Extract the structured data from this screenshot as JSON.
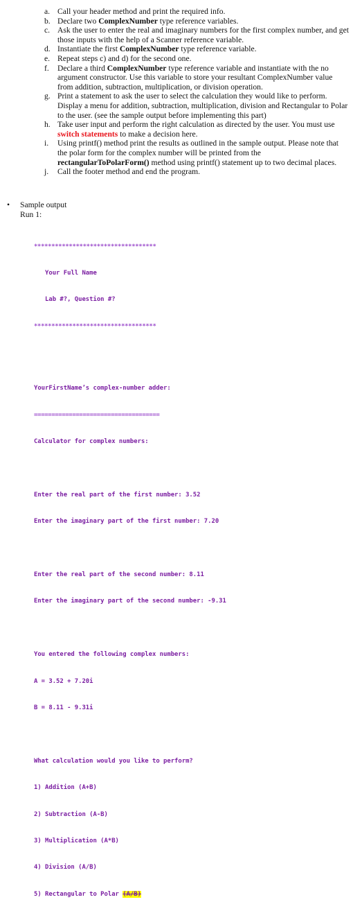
{
  "steps": [
    {
      "label": "a.",
      "parts": [
        {
          "t": "Call your header method and print the required info."
        }
      ]
    },
    {
      "label": "b.",
      "parts": [
        {
          "t": "Declare two "
        },
        {
          "t": "ComplexNumber",
          "b": true
        },
        {
          "t": " type reference variables."
        }
      ]
    },
    {
      "label": "c.",
      "parts": [
        {
          "t": "Ask the user to enter the real and imaginary numbers for the first complex number, and get those inputs with the help of a Scanner reference variable."
        }
      ]
    },
    {
      "label": "d.",
      "parts": [
        {
          "t": "Instantiate the first "
        },
        {
          "t": "ComplexNumber",
          "b": true
        },
        {
          "t": " type reference variable."
        }
      ]
    },
    {
      "label": "e.",
      "parts": [
        {
          "t": "Repeat steps c) and d) for the second one."
        }
      ]
    },
    {
      "label": "f.",
      "parts": [
        {
          "t": "Declare a third "
        },
        {
          "t": "ComplexNumber",
          "b": true
        },
        {
          "t": " type reference variable and instantiate with the no argument constructor. Use this variable to store your resultant ComplexNumber value from addition, subtraction, multiplication, or division operation."
        }
      ]
    },
    {
      "label": "g.",
      "parts": [
        {
          "t": "Print a statement to ask the user to select the calculation they would like to perform. Display a menu for addition, subtraction, multiplication, division and Rectangular to Polar to the user. (see the sample output before implementing this part)"
        }
      ]
    },
    {
      "label": "h.",
      "parts": [
        {
          "t": "Take user input and perform the right calculation as directed by the user. You must use "
        },
        {
          "t": "switch statements",
          "red": true
        },
        {
          "t": " to make a decision here."
        }
      ]
    },
    {
      "label": "i.",
      "parts": [
        {
          "t": "Using printf() method print the results as outlined in the sample output. Please note that the polar form for the complex number will be printed from the "
        },
        {
          "t": "rectangularToPolarForm()",
          "b": true
        },
        {
          "t": " method using printf() statement up to two decimal places."
        }
      ]
    },
    {
      "label": "j.",
      "parts": [
        {
          "t": "Call the footer method and end the program."
        }
      ]
    }
  ],
  "sample": {
    "bullet": "•",
    "title": "Sample output",
    "run": "Run 1:"
  },
  "console": {
    "stars": "***********************************",
    "name": "   Your Full Name",
    "lab": "   Lab #?, Question #?",
    "adder": "YourFirstName’s complex-number adder:",
    "equals": "====================================",
    "calc": "Calculator for complex numbers:",
    "real1": "Enter the real part of the first number: 3.52",
    "imag1": "Enter the imaginary part of the first number: 7.20",
    "real2": "Enter the real part of the second number: 8.11",
    "imag2": "Enter the imaginary part of the second number: -9.31",
    "entered": "You entered the following complex numbers:",
    "a": "A = 3.52 + 7.20i",
    "b": "B = 8.11 - 9.31i",
    "question": "What calculation would you like to perform?",
    "menu": [
      "1) Addition (A+B)",
      "2) Subtraction (A-B)",
      "3) Multiplication (A*B)",
      "4) Division (A/B)"
    ],
    "menu5": "5) Rectangular to Polar ",
    "menu5_struck": "(A/B)"
  }
}
